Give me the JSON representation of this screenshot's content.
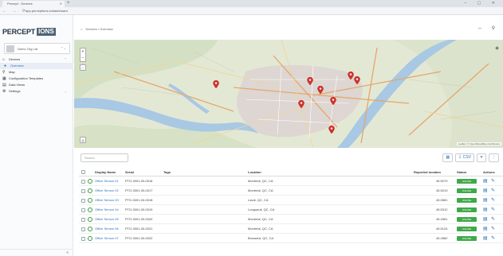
{
  "browser": {
    "tab_title": "Percept · Devices",
    "url": "app.perceptions.io/dashboard",
    "nav_icons": "← → ⟳",
    "new_tab": "+",
    "window_controls": "– ▢ ✕",
    "tab_close": "✕"
  },
  "brand": {
    "name_a": "PERCEPT",
    "name_b": "IONS",
    "colors": {
      "accent": "#2a6fb9",
      "success": "#3fa94a",
      "logo_dark": "#243447"
    }
  },
  "account": {
    "name": "Demo Org Ltd",
    "chevron": "⌃⌄"
  },
  "sidebar": {
    "items": [
      {
        "label": "Devices",
        "icon": "chip-icon",
        "glyph": "⌂",
        "chevron": "⌃"
      },
      {
        "label": "Overview",
        "icon": "map-pin-icon",
        "glyph": "●",
        "sub": true,
        "active": true
      },
      {
        "label": "Map",
        "icon": "map-icon",
        "glyph": "⚲"
      },
      {
        "label": "Configuration Templates",
        "icon": "template-icon",
        "glyph": "▦"
      },
      {
        "label": "Data Views",
        "icon": "chart-icon",
        "glyph": "▤"
      },
      {
        "label": "Settings",
        "icon": "gear-icon",
        "glyph": "⚙",
        "chevron": "⌄"
      }
    ],
    "collapse": "«"
  },
  "header": {
    "home": "⌂",
    "breadcrumb": "Devices  /  Overview",
    "icons": "⇔ ⚲"
  },
  "map": {
    "zoom_in": "+",
    "zoom_out": "−",
    "fullscreen": "⛶",
    "layers": "◈",
    "attribution": "Leaflet | © OpenStreetMap contributors",
    "pins": [
      {
        "lat": 0.45,
        "lng": 0.33
      },
      {
        "lat": 0.42,
        "lng": 0.55
      },
      {
        "lat": 0.5,
        "lng": 0.575
      },
      {
        "lat": 0.6,
        "lng": 0.605
      },
      {
        "lat": 0.63,
        "lng": 0.53
      },
      {
        "lat": 0.37,
        "lng": 0.645
      },
      {
        "lat": 0.41,
        "lng": 0.66
      },
      {
        "lat": 0.87,
        "lng": 0.6
      }
    ]
  },
  "toolbar": {
    "search_placeholder": "Search",
    "view_toggle": "▦",
    "export": "⇩ CSV",
    "filter": "⏷",
    "more": "⋮"
  },
  "table": {
    "columns": [
      "Display Name",
      "Serial",
      "Tags",
      "Location",
      "Reported location",
      "Status",
      "Actions"
    ],
    "rows": [
      {
        "name": "Office Sensor 01",
        "serial": "PTO-3001-00-0016",
        "location": "Montréal, QC, CA",
        "reported": "45.5079",
        "status": "ONLINE"
      },
      {
        "name": "Office Sensor 02",
        "serial": "PTO-3001-00-0017",
        "location": "Montréal, QC, CA",
        "reported": "45.5013",
        "status": "ONLINE"
      },
      {
        "name": "Office Sensor 03",
        "serial": "PTO-3001-00-0018",
        "location": "Laval, QC, CA",
        "reported": "45.5581",
        "status": "ONLINE"
      },
      {
        "name": "Office Sensor 04",
        "serial": "PTO-3001-00-0019",
        "location": "Longueuil, QC, CA",
        "reported": "45.5312",
        "status": "ONLINE"
      },
      {
        "name": "Office Sensor 05",
        "serial": "PTO-3001-00-0020",
        "location": "Montréal, QC, CA",
        "reported": "45.4961",
        "status": "ONLINE"
      },
      {
        "name": "Office Sensor 06",
        "serial": "PTO-3001-00-0021",
        "location": "Montréal, QC, CA",
        "reported": "45.5124",
        "status": "ONLINE"
      },
      {
        "name": "Office Sensor 07",
        "serial": "PTO-3001-00-0022",
        "location": "Brossard, QC, CA",
        "reported": "45.4582",
        "status": "ONLINE"
      }
    ],
    "action_icons": {
      "chart": "▤",
      "edit": "✎"
    }
  }
}
